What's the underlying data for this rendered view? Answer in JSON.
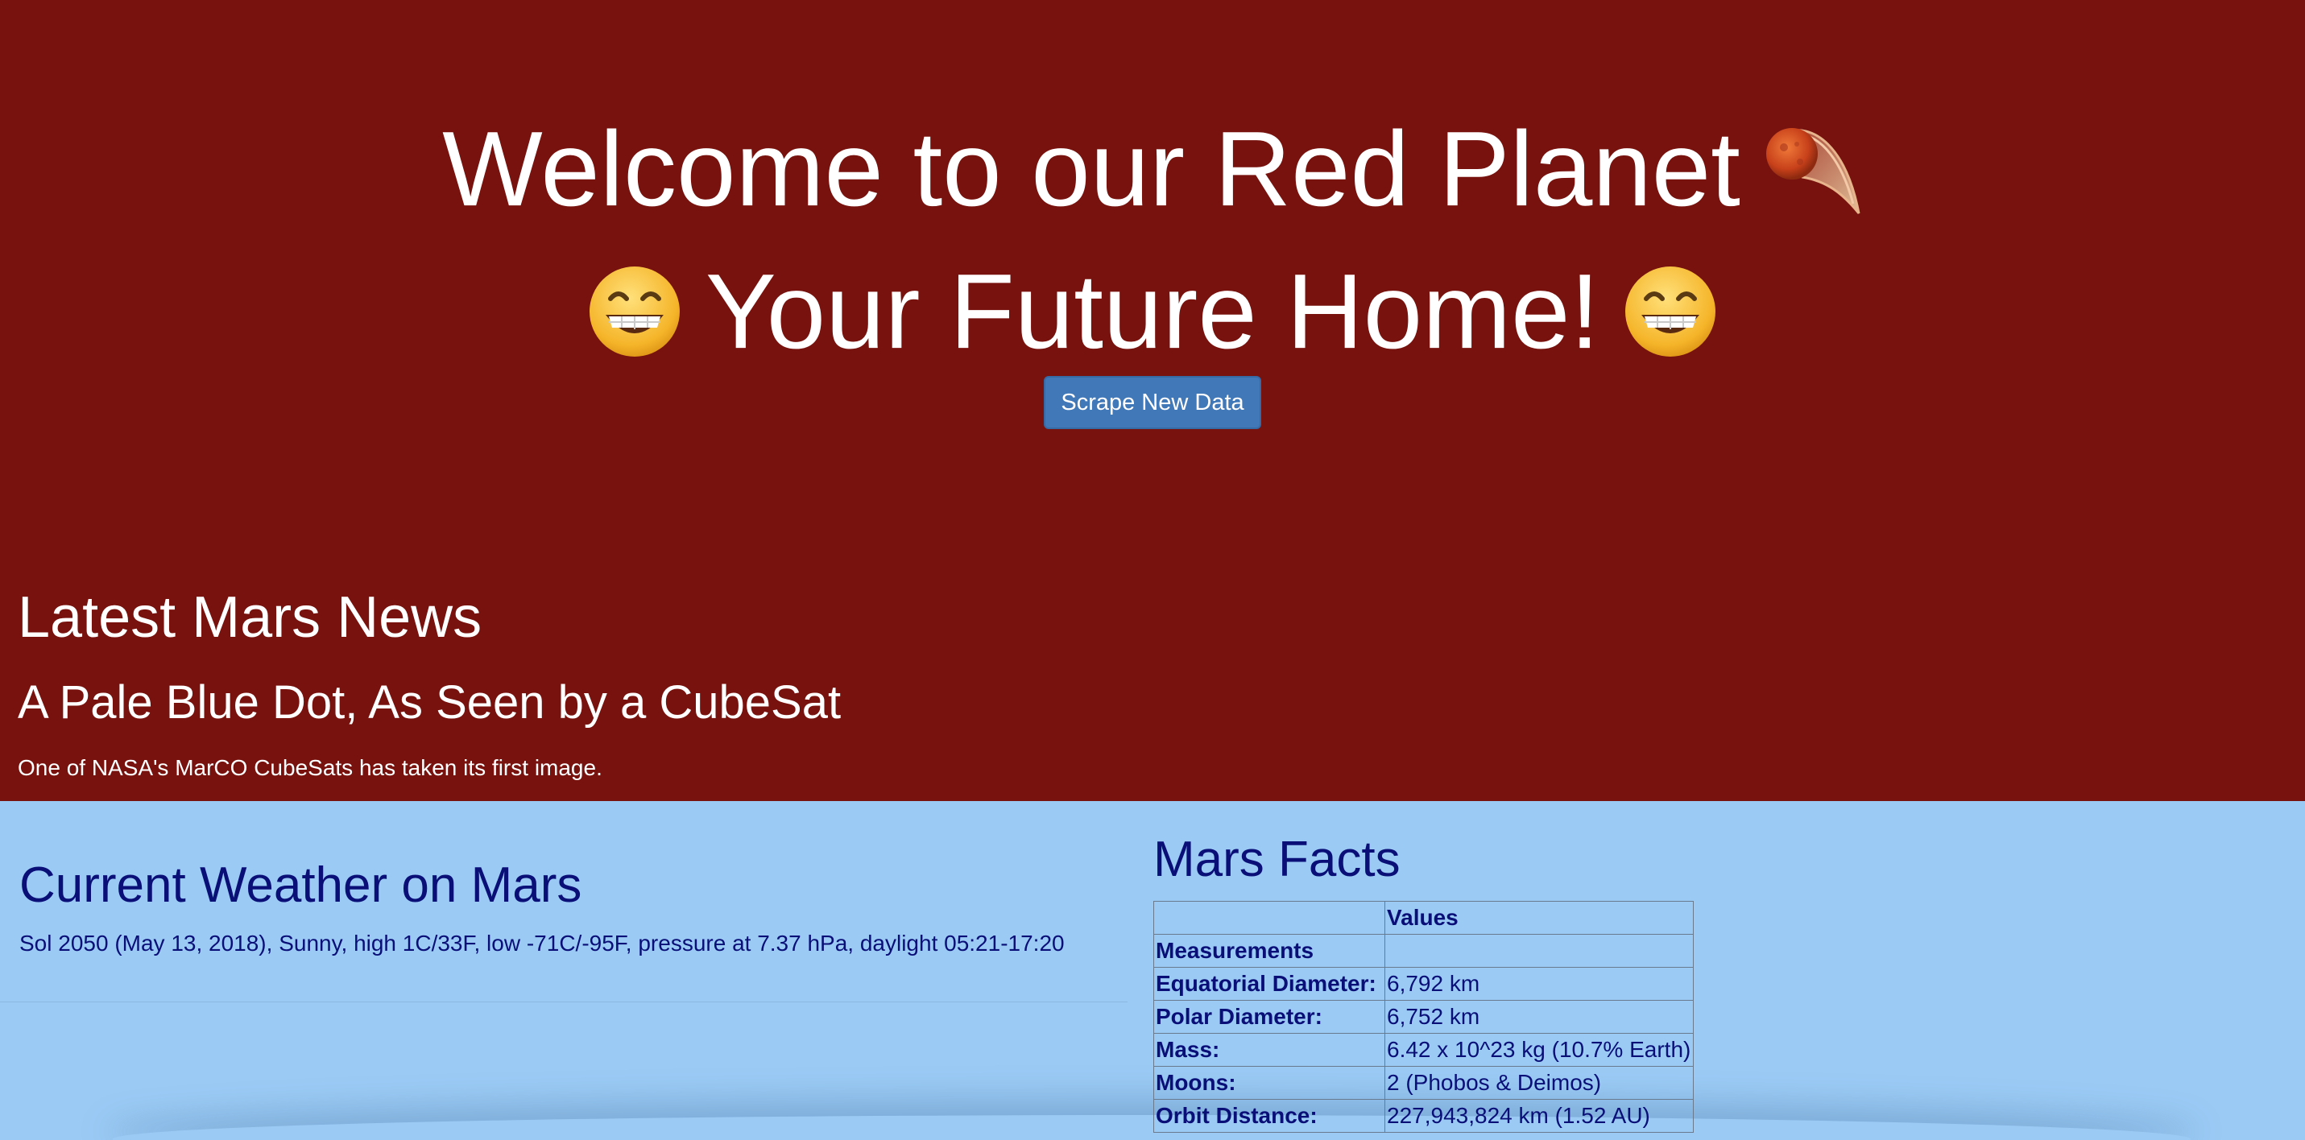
{
  "hero": {
    "line1": "Welcome to our Red Planet",
    "line1_icon": "meteor-icon",
    "line2": "Your Future Home!",
    "line2_icons": [
      "grinning-face-icon",
      "grinning-face-icon"
    ],
    "scrape_button_label": "Scrape New Data"
  },
  "news": {
    "heading": "Latest Mars News",
    "title": "A Pale Blue Dot, As Seen by a CubeSat",
    "teaser": "One of NASA's MarCO CubeSats has taken its first image."
  },
  "weather": {
    "heading": "Current Weather on Mars",
    "text": "Sol 2050 (May 13, 2018), Sunny, high 1C/33F, low -71C/-95F, pressure at 7.37 hPa, daylight 05:21-17:20"
  },
  "facts": {
    "heading": "Mars Facts",
    "column_header": "Values",
    "index_header": "Measurements",
    "rows": [
      {
        "key": "Equatorial Diameter:",
        "value": "6,792 km"
      },
      {
        "key": "Polar Diameter:",
        "value": "6,752 km"
      },
      {
        "key": "Mass:",
        "value": "6.42 x 10^23 kg (10.7% Earth)"
      },
      {
        "key": "Moons:",
        "value": "2 (Phobos & Deimos)"
      },
      {
        "key": "Orbit Distance:",
        "value": "227,943,824 km (1.52 AU)"
      }
    ]
  },
  "colors": {
    "hero_background": "#77120e",
    "lower_background": "#9bcbf5",
    "lower_text": "#0a0f78",
    "button": "#4178b8"
  }
}
